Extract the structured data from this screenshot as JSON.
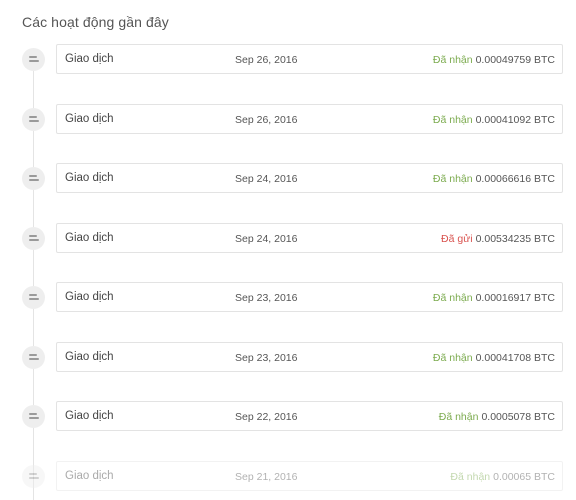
{
  "header": {
    "title": "Các hoạt động gần đây"
  },
  "colors": {
    "received": "#7cab4f",
    "sent": "#d9534f"
  },
  "activities": [
    {
      "label": "Giao dịch",
      "date": "Sep 26, 2016",
      "status": "Đã nhận",
      "type": "received",
      "amount": "0.00049759 BTC"
    },
    {
      "label": "Giao dịch",
      "date": "Sep 26, 2016",
      "status": "Đã nhận",
      "type": "received",
      "amount": "0.00041092 BTC"
    },
    {
      "label": "Giao dịch",
      "date": "Sep 24, 2016",
      "status": "Đã nhận",
      "type": "received",
      "amount": "0.00066616 BTC"
    },
    {
      "label": "Giao dịch",
      "date": "Sep 24, 2016",
      "status": "Đã gửi",
      "type": "sent",
      "amount": "0.00534235 BTC"
    },
    {
      "label": "Giao dịch",
      "date": "Sep 23, 2016",
      "status": "Đã nhận",
      "type": "received",
      "amount": "0.00016917 BTC"
    },
    {
      "label": "Giao dịch",
      "date": "Sep 23, 2016",
      "status": "Đã nhận",
      "type": "received",
      "amount": "0.00041708 BTC"
    },
    {
      "label": "Giao dịch",
      "date": "Sep 22, 2016",
      "status": "Đã nhận",
      "type": "received",
      "amount": "0.0005078 BTC"
    },
    {
      "label": "Giao dịch",
      "date": "Sep 21, 2016",
      "status": "Đã nhận",
      "type": "received",
      "amount": "0.00065 BTC"
    }
  ],
  "icons": {
    "activity": "transaction-icon"
  }
}
